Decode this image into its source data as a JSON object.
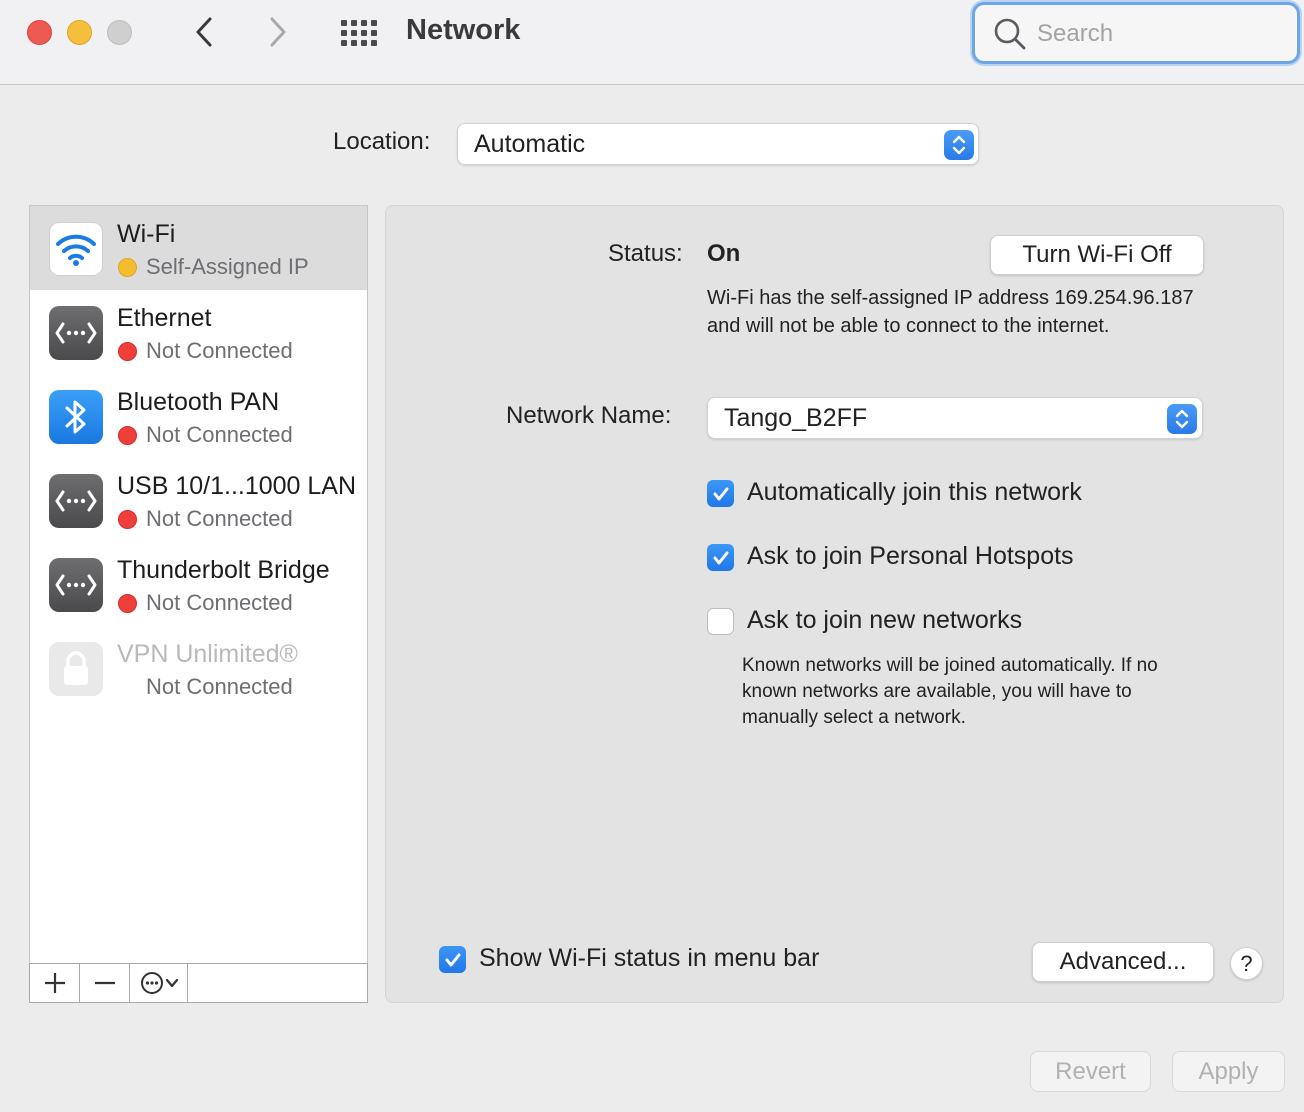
{
  "window": {
    "title": "Network",
    "search_placeholder": "Search"
  },
  "location": {
    "label": "Location:",
    "value": "Automatic"
  },
  "services": [
    {
      "name": "Wi-Fi",
      "status": "Self-Assigned IP",
      "status_color": "#f4bd2f",
      "icon": "wifi-icon",
      "selected": true
    },
    {
      "name": "Ethernet",
      "status": "Not Connected",
      "status_color": "#ef3f3a",
      "icon": "ethernet-icon"
    },
    {
      "name": "Bluetooth PAN",
      "status": "Not Connected",
      "status_color": "#ef3f3a",
      "icon": "bluetooth-icon"
    },
    {
      "name": "USB 10/1...1000 LAN",
      "status": "Not Connected",
      "status_color": "#ef3f3a",
      "icon": "ethernet-icon"
    },
    {
      "name": "Thunderbolt Bridge",
      "status": "Not Connected",
      "status_color": "#ef3f3a",
      "icon": "ethernet-icon"
    },
    {
      "name": "VPN Unlimited®",
      "status": "Not Connected",
      "icon": "lock-icon"
    }
  ],
  "detail": {
    "status_label": "Status:",
    "status_value": "On",
    "turn_off_button": "Turn Wi-Fi Off",
    "status_description": "Wi-Fi has the self-assigned IP address 169.254.96.187 and will not be able to connect to the internet.",
    "network_name_label": "Network Name:",
    "network_name_value": "Tango_B2FF",
    "auto_join": {
      "label": "Automatically join this network",
      "checked": true
    },
    "ask_hotspots": {
      "label": "Ask to join Personal Hotspots",
      "checked": true
    },
    "ask_new": {
      "label": "Ask to join new networks",
      "checked": false
    },
    "join_description": "Known networks will be joined automatically. If no known networks are available, you will have to manually select a network.",
    "show_status": {
      "label": "Show Wi-Fi status in menu bar",
      "checked": true
    },
    "advanced_button": "Advanced...",
    "help_button": "?"
  },
  "footer": {
    "revert_button": "Revert",
    "apply_button": "Apply"
  },
  "colors": {
    "accent": "#2a7ae6",
    "status_connected_partial": "#f4bd2f",
    "status_not_connected": "#ef3f3a"
  }
}
